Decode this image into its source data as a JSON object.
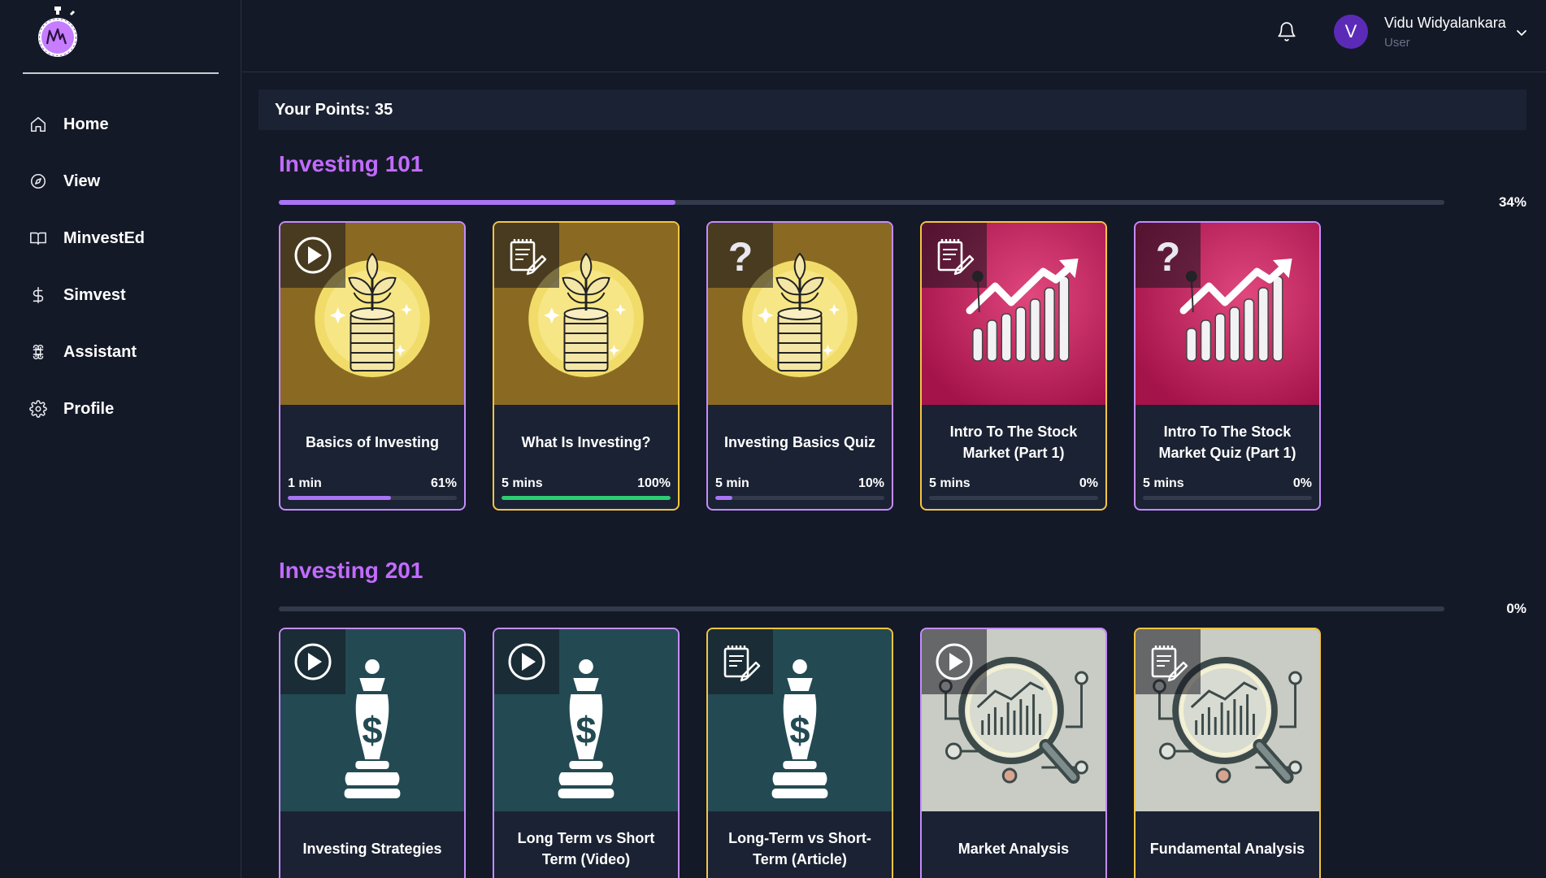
{
  "user": {
    "initial": "V",
    "name": "Vidu Widyalankara",
    "role": "User"
  },
  "nav": [
    {
      "label": "Home",
      "icon": "home-icon"
    },
    {
      "label": "View",
      "icon": "compass-icon"
    },
    {
      "label": "MinvestEd",
      "icon": "book-icon"
    },
    {
      "label": "Simvest",
      "icon": "dollar-icon"
    },
    {
      "label": "Assistant",
      "icon": "command-icon"
    },
    {
      "label": "Profile",
      "icon": "gear-icon"
    }
  ],
  "points_label": "Your Points: 35",
  "colors": {
    "accent": "#c26bff",
    "progress": "#a874f5",
    "complete": "#2ecc71",
    "gold_border": "#f5c542",
    "purple_border": "#c48cff"
  },
  "sections": [
    {
      "title": "Investing 101",
      "progress": 34,
      "progress_label": "34%",
      "cards": [
        {
          "title": "Basics of Investing",
          "type": "video",
          "duration": "1 min",
          "progress": 61,
          "progress_label": "61%",
          "image": "coin-plant",
          "border": "purple"
        },
        {
          "title": "What Is Investing?",
          "type": "article",
          "duration": "5 mins",
          "progress": 100,
          "progress_label": "100%",
          "image": "coin-plant",
          "border": "gold"
        },
        {
          "title": "Investing Basics Quiz",
          "type": "quiz",
          "duration": "5 min",
          "progress": 10,
          "progress_label": "10%",
          "image": "coin-plant",
          "border": "purple"
        },
        {
          "title": "Intro To The Stock Market (Part 1)",
          "type": "article",
          "duration": "5 mins",
          "progress": 0,
          "progress_label": "0%",
          "image": "stock-chart",
          "border": "gold"
        },
        {
          "title": "Intro To The Stock Market Quiz (Part 1)",
          "type": "quiz",
          "duration": "5 mins",
          "progress": 0,
          "progress_label": "0%",
          "image": "stock-chart",
          "border": "purple"
        }
      ]
    },
    {
      "title": "Investing 201",
      "progress": 0,
      "progress_label": "0%",
      "cards": [
        {
          "title": "Investing Strategies",
          "type": "video",
          "image": "chess-king",
          "border": "purple"
        },
        {
          "title": "Long Term vs Short Term (Video)",
          "type": "video",
          "image": "chess-king",
          "border": "purple"
        },
        {
          "title": "Long-Term vs Short-Term (Article)",
          "type": "article",
          "image": "chess-king",
          "border": "gold"
        },
        {
          "title": "Market Analysis",
          "type": "video",
          "image": "magnifier",
          "border": "purple"
        },
        {
          "title": "Fundamental Analysis",
          "type": "article",
          "image": "magnifier",
          "border": "gold"
        }
      ]
    }
  ]
}
